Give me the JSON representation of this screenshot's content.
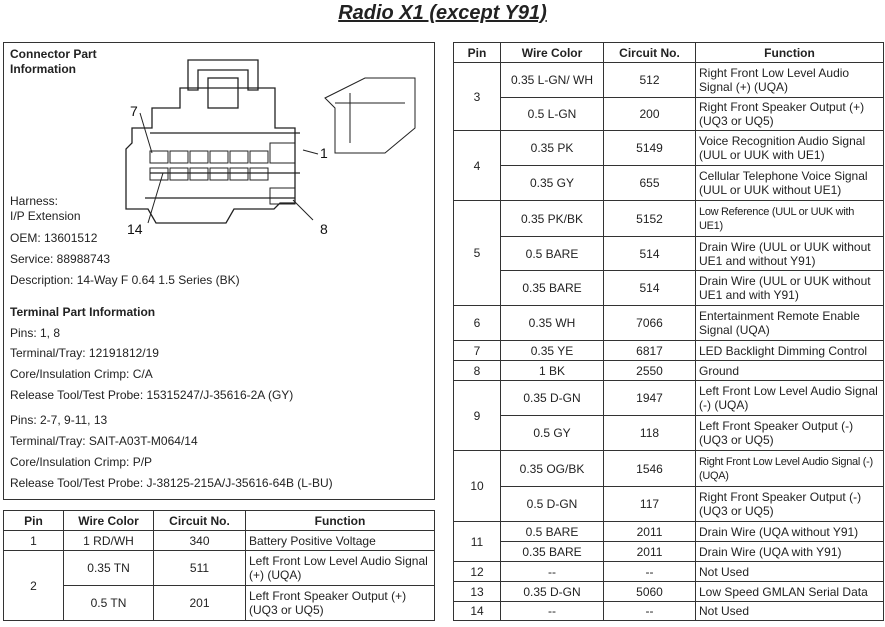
{
  "title": "Radio X1 (except Y91)",
  "connector_info": {
    "heading": "Connector Part Information",
    "harness_label": "Harness:",
    "harness": "I/P Extension",
    "oem": "OEM: 13601512",
    "service": "Service: 88988743",
    "description": "Description: 14-Way F 0.64 1.5 Series (BK)",
    "callouts": [
      "7",
      "1",
      "14",
      "8"
    ]
  },
  "terminal_info": {
    "heading": "Terminal Part Information",
    "groups": [
      {
        "pins": "Pins: 1, 8",
        "tray": "Terminal/Tray: 12191812/19",
        "crimp": "Core/Insulation Crimp: C/A",
        "tool": "Release Tool/Test Probe: 15315247/J-35616-2A (GY)"
      },
      {
        "pins": "Pins: 2-7, 9-11, 13",
        "tray": "Terminal/Tray: SAIT-A03T-M064/14",
        "crimp": "Core/Insulation Crimp: P/P",
        "tool": "Release Tool/Test Probe: J-38125-215A/J-35616-64B (L-BU)"
      }
    ]
  },
  "headers": [
    "Pin",
    "Wire Color",
    "Circuit No.",
    "Function"
  ],
  "left_table": [
    {
      "pin": "1",
      "wire": "1 RD/WH",
      "circuit": "340",
      "function": "Battery Positive Voltage"
    },
    {
      "pin": "2",
      "wire": "0.35 TN",
      "circuit": "511",
      "function": "Left Front Low Level Audio Signal (+) (UQA)"
    },
    {
      "wire": "0.5 TN",
      "circuit": "201",
      "function": "Left Front Speaker Output (+) (UQ3 or UQ5)"
    }
  ],
  "right_table": [
    {
      "pin": "3",
      "wire": "0.35 L-GN/ WH",
      "circuit": "512",
      "function": "Right Front Low Level Audio Signal (+) (UQA)"
    },
    {
      "wire": "0.5 L-GN",
      "circuit": "200",
      "function": "Right Front Speaker Output (+) (UQ3 or UQ5)"
    },
    {
      "pin": "4",
      "wire": "0.35 PK",
      "circuit": "5149",
      "function": "Voice Recognition Audio Signal (UUL or UUK with UE1)"
    },
    {
      "wire": "0.35 GY",
      "circuit": "655",
      "function": "Cellular Telephone Voice Signal (UUL or UUK without UE1)"
    },
    {
      "pin": "5",
      "wire": "0.35 PK/BK",
      "circuit": "5152",
      "function": "Low Reference (UUL or UUK with UE1)"
    },
    {
      "wire": "0.5 BARE",
      "circuit": "514",
      "function": "Drain Wire (UUL or UUK without UE1 and without Y91)"
    },
    {
      "wire": "0.35 BARE",
      "circuit": "514",
      "function": "Drain Wire (UUL or UUK without UE1 and with Y91)"
    },
    {
      "pin": "6",
      "wire": "0.35 WH",
      "circuit": "7066",
      "function": "Entertainment Remote Enable Signal (UQA)"
    },
    {
      "pin": "7",
      "wire": "0.35 YE",
      "circuit": "6817",
      "function": "LED Backlight Dimming Control"
    },
    {
      "pin": "8",
      "wire": "1 BK",
      "circuit": "2550",
      "function": "Ground"
    },
    {
      "pin": "9",
      "wire": "0.35 D-GN",
      "circuit": "1947",
      "function": "Left Front Low Level Audio Signal (-) (UQA)"
    },
    {
      "wire": "0.5 GY",
      "circuit": "118",
      "function": "Left Front Speaker Output (-) (UQ3 or UQ5)"
    },
    {
      "pin": "10",
      "wire": "0.35 OG/BK",
      "circuit": "1546",
      "function": "Right Front Low Level Audio Signal (-) (UQA)"
    },
    {
      "wire": "0.5 D-GN",
      "circuit": "117",
      "function": "Right Front Speaker Output (-) (UQ3 or UQ5)"
    },
    {
      "pin": "11",
      "wire": "0.5 BARE",
      "circuit": "2011",
      "function": "Drain Wire (UQA without Y91)"
    },
    {
      "wire": "0.35 BARE",
      "circuit": "2011",
      "function": "Drain Wire (UQA with Y91)"
    },
    {
      "pin": "12",
      "wire": "--",
      "circuit": "--",
      "function": "Not Used"
    },
    {
      "pin": "13",
      "wire": "0.35 D-GN",
      "circuit": "5060",
      "function": "Low Speed GMLAN Serial Data"
    },
    {
      "pin": "14",
      "wire": "--",
      "circuit": "--",
      "function": "Not Used"
    }
  ]
}
